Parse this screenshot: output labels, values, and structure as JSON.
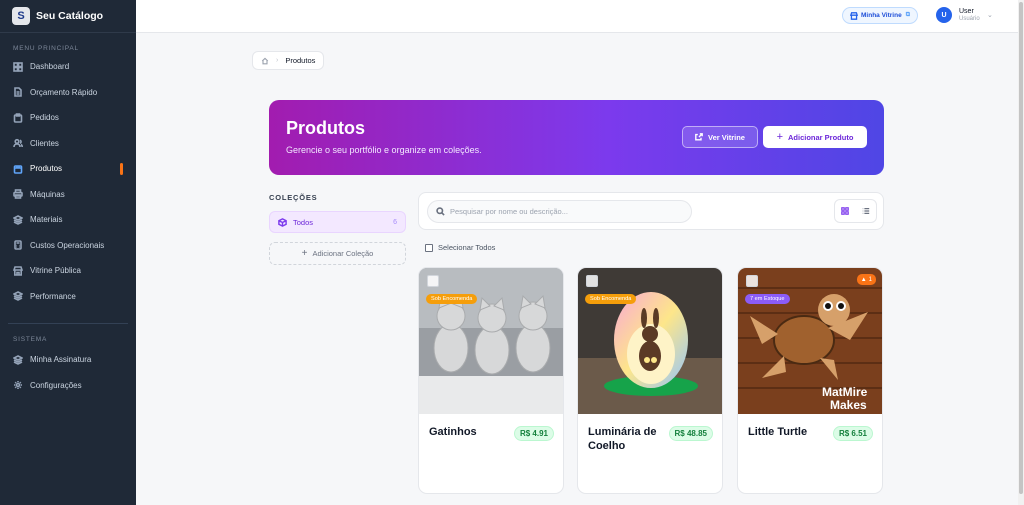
{
  "app": {
    "name": "Seu Catálogo",
    "logo_letter": "S"
  },
  "sidebar": {
    "section_main": "MENU PRINCIPAL",
    "items": [
      {
        "label": "Dashboard",
        "icon": "dashboard-icon"
      },
      {
        "label": "Orçamento Rápido",
        "icon": "document-icon"
      },
      {
        "label": "Pedidos",
        "icon": "clipboard-icon"
      },
      {
        "label": "Clientes",
        "icon": "users-icon"
      },
      {
        "label": "Produtos",
        "icon": "box-icon",
        "active": true
      },
      {
        "label": "Máquinas",
        "icon": "printer-icon"
      },
      {
        "label": "Materiais",
        "icon": "layers-icon"
      },
      {
        "label": "Custos Operacionais",
        "icon": "calculator-icon"
      },
      {
        "label": "Vitrine Pública",
        "icon": "storefront-icon"
      },
      {
        "label": "Performance",
        "icon": "chart-icon"
      }
    ],
    "section_system": "SISTEMA",
    "system_items": [
      {
        "label": "Minha Assinatura",
        "icon": "layers-icon"
      },
      {
        "label": "Configurações",
        "icon": "gear-icon"
      }
    ]
  },
  "topbar": {
    "vitrine_link": "Minha Vitrine",
    "user_initial": "U",
    "user_name": "User",
    "user_role": "Usuário"
  },
  "breadcrumb": {
    "home_icon": "home-icon",
    "current": "Produtos"
  },
  "hero": {
    "title": "Produtos",
    "subtitle": "Gerencie o seu portfólio e organize em coleções.",
    "view_button": "Ver Vitrine",
    "add_button": "Adicionar Produto"
  },
  "collections": {
    "title": "COLEÇÕES",
    "items": [
      {
        "label": "Todos",
        "count": "6"
      }
    ],
    "add_label": "Adicionar Coleção"
  },
  "search": {
    "placeholder": "Pesquisar por nome ou descrição..."
  },
  "select_all": "Selecionar Todos",
  "products": [
    {
      "name": "Gatinhos",
      "price": "R$ 4.91",
      "tag": "Sob Encomenda"
    },
    {
      "name": "Luminária de Coelho",
      "price": "R$ 48.85",
      "tag": "Sob Encomenda"
    },
    {
      "name": "Little Turtle",
      "price": "R$ 6.51",
      "tag": "7 em Estoque",
      "badge": "1",
      "image_text_1": "MatMire",
      "image_text_2": "Makes"
    }
  ],
  "colors": {
    "accent": "#7c3aed",
    "sidebar_bg": "#1f2937",
    "active_marker": "#f97316",
    "price_green": "#15803d"
  }
}
